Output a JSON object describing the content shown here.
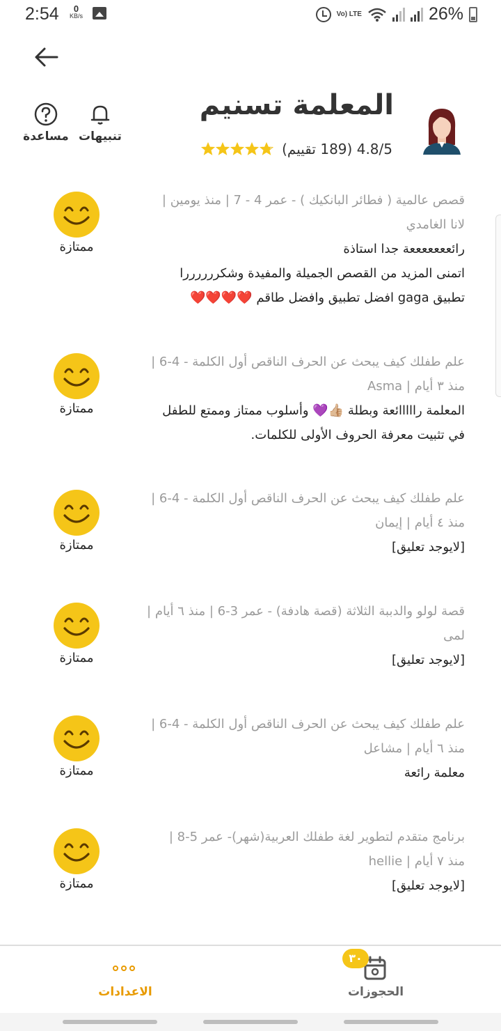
{
  "status_bar": {
    "time": "2:54",
    "net_speed_value": "0",
    "net_speed_unit": "KB/s",
    "volte": "Vo) LTE",
    "battery": "26%"
  },
  "header": {
    "teacher_name": "المعلمة تسنيم",
    "rating_text": "4.8/5 (189 تقييم)",
    "rating_value": 4.8,
    "notifications_label": "تنبيهات",
    "help_label": "مساعدة"
  },
  "reviews": [
    {
      "meta": [
        "قصص عالمية ( فطائر البانكيك ) - عمر 4 - 7 | منذ يومين |",
        "لانا الغامدي"
      ],
      "body": [
        "رائعععععععة جدا استاذة",
        "اتمنى المزيد من القصص الجميلة والمفيدة وشكررررررا",
        "تطبيق gaga افضل تطبيق وافضل طاقم ❤️❤️❤️❤️"
      ],
      "grade": "ممتازة"
    },
    {
      "meta": [
        "علم طفلك كيف يبحث عن الحرف الناقص أول الكلمة - 4-6 |",
        "منذ ٣ أيام | Asma"
      ],
      "body": [
        "المعلمة رااااائعة وبطلة 👍🏼💜 وأسلوب ممتاز وممتع للطفل",
        "في تثبيت معرفة الحروف الأولى للكلمات."
      ],
      "grade": "ممتازة"
    },
    {
      "meta": [
        "علم طفلك كيف يبحث عن الحرف الناقص أول الكلمة - 4-6 |",
        "منذ ٤ أيام | إيمان"
      ],
      "body": [
        "[لايوجد تعليق]"
      ],
      "grade": "ممتازة"
    },
    {
      "meta": [
        "قصة لولو والدببة الثلاثة (قصة هادفة) - عمر 3-6 | منذ ٦ أيام |",
        "لمى"
      ],
      "body": [
        "[لايوجد تعليق]"
      ],
      "grade": "ممتازة"
    },
    {
      "meta": [
        "علم طفلك كيف يبحث عن الحرف الناقص أول الكلمة - 4-6 |",
        "منذ ٦ أيام | مشاعل"
      ],
      "body": [
        "معلمة رائعة"
      ],
      "grade": "ممتازة"
    },
    {
      "meta": [
        "برنامج متقدم لتطوير لغة طفلك العربية(شهر)- عمر 5-8 |",
        "منذ ٧ أيام | hellie"
      ],
      "body": [
        "[لايوجد تعليق]"
      ],
      "grade": "ممتازة"
    }
  ],
  "bottom_nav": {
    "settings_label": "الاعدادات",
    "bookings_label": "الحجوزات",
    "bookings_badge": "٣٠"
  },
  "colors": {
    "accent": "#e89a00",
    "star": "#f5c518",
    "face": "#f5c518",
    "meta_text": "#9a9a9a"
  }
}
